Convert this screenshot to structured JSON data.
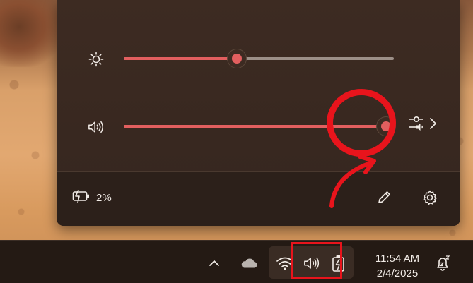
{
  "quick_settings": {
    "brightness": {
      "icon": "sun-icon",
      "level": 0.42
    },
    "volume": {
      "icon": "speaker-icon",
      "level": 0.97
    },
    "mixer": {
      "icon": "sound-mixer-icon",
      "chevron": "chevron-right-icon"
    },
    "battery": {
      "icon": "battery-charging-icon",
      "percent_label": "2%"
    },
    "edit": {
      "icon": "pencil-icon"
    },
    "settings": {
      "icon": "gear-icon"
    }
  },
  "taskbar": {
    "show_hidden_icons": "chevron-up-icon",
    "onedrive": "cloud-icon",
    "wifi": "wifi-icon",
    "speaker": "speaker-icon",
    "battery": "battery-charging-icon",
    "time": "11:54 AM",
    "date": "2/4/2025",
    "notifications": "notification-bell-snooze-icon"
  },
  "annotations": {
    "highlight_color": "#e8141c"
  },
  "colors": {
    "accent": "#e25f5f",
    "panel": "#3d2b22",
    "taskbar": "#241a14"
  }
}
